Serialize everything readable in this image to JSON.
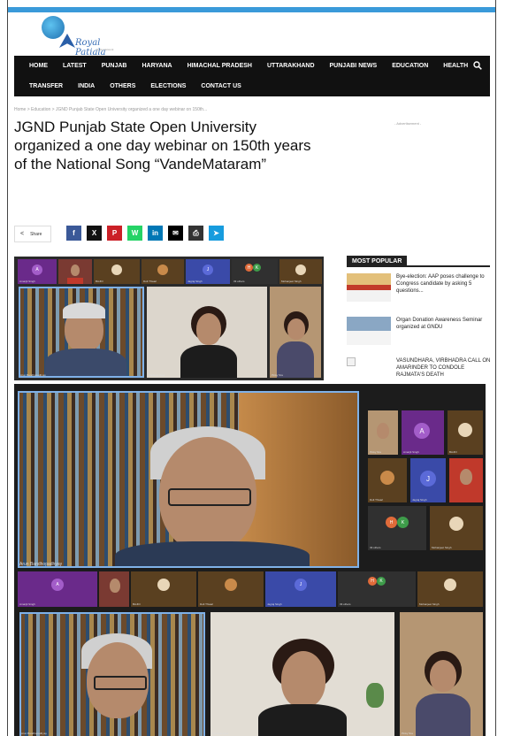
{
  "site": {
    "logo_text": "Royal Patiala",
    "logo_tagline": "News Network"
  },
  "nav": {
    "row1": [
      "HOME",
      "LATEST",
      "PUNJAB",
      "HARYANA",
      "HIMACHAL PRADESH",
      "UTTARAKHAND",
      "PUNJABI NEWS",
      "EDUCATION",
      "HEALTH"
    ],
    "row2": [
      "TRANSFER",
      "INDIA",
      "OTHERS",
      "ELECTIONS",
      "CONTACT US"
    ],
    "search_icon": "search-icon"
  },
  "breadcrumb": "Home  >  Education  >  JGND Punjab State Open University organized a one day webinar on 150th...",
  "article": {
    "title": "JGND Punjab State Open University organized a one day webinar on 150th years of the National Song “VandeMataram”"
  },
  "advertisement_label": "- Advertisement -",
  "share": {
    "label": "Share",
    "buttons": [
      {
        "icon": "facebook-icon",
        "glyph": "f",
        "color": "#3b5998"
      },
      {
        "icon": "x-icon",
        "glyph": "X",
        "color": "#111111"
      },
      {
        "icon": "pinterest-icon",
        "glyph": "P",
        "color": "#cb2027"
      },
      {
        "icon": "whatsapp-icon",
        "glyph": "W",
        "color": "#25d366"
      },
      {
        "icon": "linkedin-icon",
        "glyph": "in",
        "color": "#0077b5"
      },
      {
        "icon": "email-icon",
        "glyph": "✉",
        "color": "#000000"
      },
      {
        "icon": "print-icon",
        "glyph": "⎙",
        "color": "#333333"
      },
      {
        "icon": "telegram-icon",
        "glyph": "➤",
        "color": "#179cde"
      }
    ]
  },
  "most_popular": {
    "heading": "MOST POPULAR",
    "items": [
      {
        "text": "Bye-election: AAP poses challenge to Congress candidate by asking 5 questions..."
      },
      {
        "text": "Organ Donation Awareness Seminar organized at GNDU"
      },
      {
        "text": "VASUNDHARA, VIRBHADRA CALL ON AMARINDER TO CONDOLE RAJMATA'S DEATH"
      }
    ]
  },
  "meeting": {
    "participants": [
      "Amarjit Singh",
      "BAJIO",
      "Dolt Thwari",
      "Jagraj Singh",
      "33 others",
      "Mohanjeet Singh",
      "Pinky Sra",
      "Arun Bandhopadhyay",
      "Pardeep Kaur"
    ]
  },
  "colors": {
    "accent": "#3a9ad9",
    "nav_bg": "#111111"
  }
}
